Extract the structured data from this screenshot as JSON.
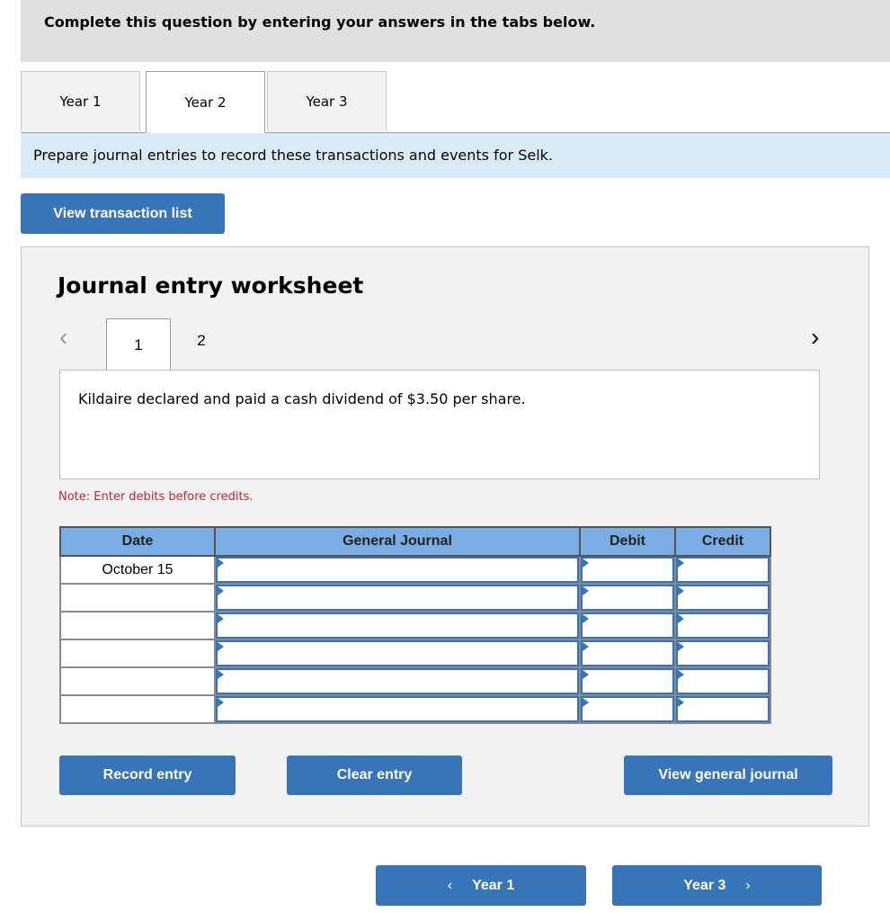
{
  "banner": {
    "text": "Complete this question by entering your answers in the tabs below."
  },
  "tabs": [
    {
      "label": "Year 1",
      "active": false
    },
    {
      "label": "Year 2",
      "active": true
    },
    {
      "label": "Year 3",
      "active": false
    }
  ],
  "instruction": "Prepare journal entries to record these transactions and events for Selk.",
  "view_transaction_list_label": "View transaction list",
  "worksheet": {
    "title": "Journal entry worksheet",
    "prev_icon": "chevron-left-icon",
    "next_icon": "chevron-right-icon",
    "entry_tabs": [
      {
        "label": "1",
        "active": true
      },
      {
        "label": "2",
        "active": false
      }
    ],
    "description": "Kildaire declared and paid a cash dividend of $3.50 per share.",
    "note": "Note: Enter debits before credits.",
    "table": {
      "headers": [
        "Date",
        "General Journal",
        "Debit",
        "Credit"
      ],
      "rows": [
        {
          "date": "October 15",
          "account": "",
          "debit": "",
          "credit": ""
        },
        {
          "date": "",
          "account": "",
          "debit": "",
          "credit": ""
        },
        {
          "date": "",
          "account": "",
          "debit": "",
          "credit": ""
        },
        {
          "date": "",
          "account": "",
          "debit": "",
          "credit": ""
        },
        {
          "date": "",
          "account": "",
          "debit": "",
          "credit": ""
        },
        {
          "date": "",
          "account": "",
          "debit": "",
          "credit": ""
        }
      ]
    },
    "buttons": {
      "record": "Record entry",
      "clear": "Clear entry",
      "view_journal": "View general journal"
    }
  },
  "nav": {
    "prev_label": "Year 1",
    "next_label": "Year 3",
    "prev_icon": "chevron-left-icon",
    "next_icon": "chevron-right-icon"
  },
  "colors": {
    "button_blue": "#3875b8",
    "header_blue": "#79ade3",
    "instruction_bg": "#daebf8",
    "note_red": "#c0272d"
  }
}
